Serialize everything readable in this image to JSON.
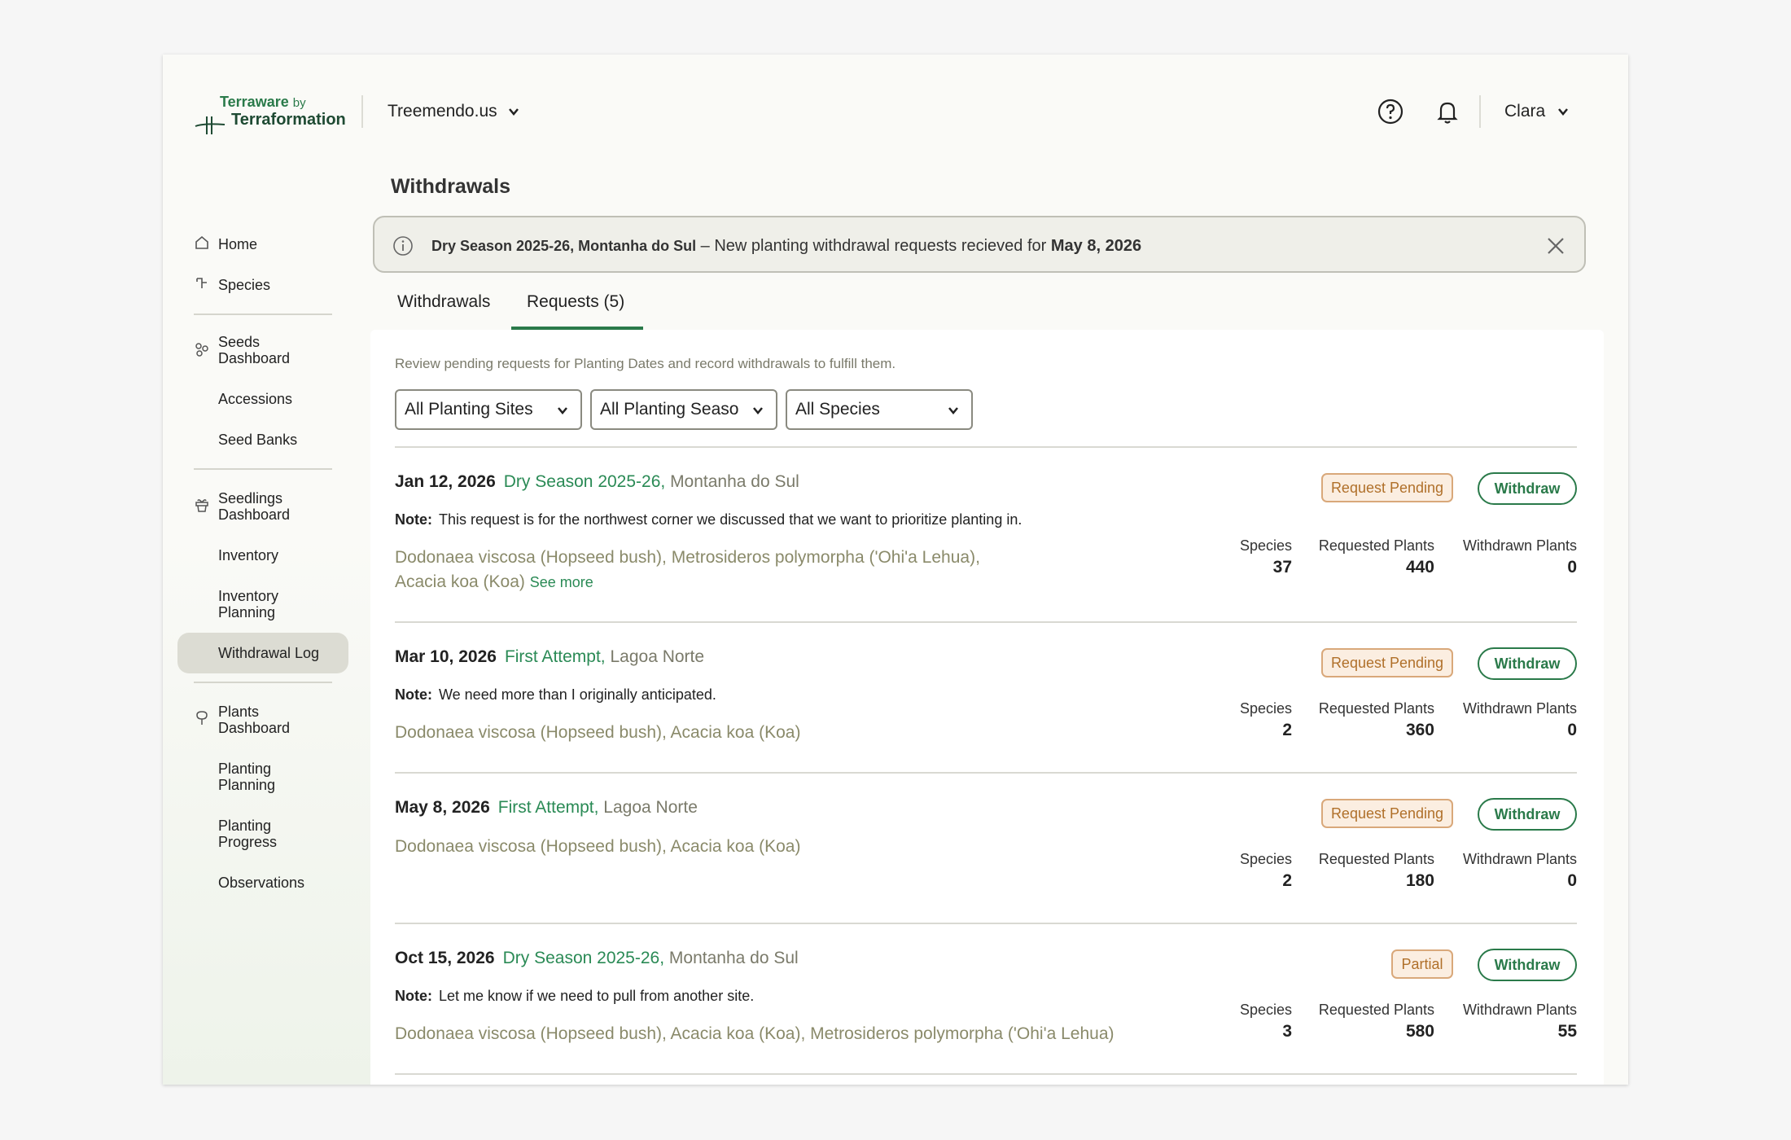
{
  "header": {
    "brand_top": "Terraware",
    "brand_by": "by",
    "brand_bottom": "Terraformation",
    "org_name": "Treemendo.us",
    "user_name": "Clara"
  },
  "sidebar": {
    "home": "Home",
    "species": "Species",
    "seeds_dashboard": [
      "Seeds",
      "Dashboard"
    ],
    "accessions": "Accessions",
    "seed_banks": "Seed Banks",
    "seedlings_dashboard": [
      "Seedlings",
      "Dashboard"
    ],
    "inventory": "Inventory",
    "inventory_planning": [
      "Inventory",
      "Planning"
    ],
    "withdrawal_log": "Withdrawal Log",
    "plants_dashboard": [
      "Plants",
      "Dashboard"
    ],
    "planting_planning": [
      "Planting",
      "Planning"
    ],
    "planting_progress": [
      "Planting",
      "Progress"
    ],
    "observations": "Observations"
  },
  "page": {
    "title": "Withdrawals"
  },
  "banner": {
    "bold_prefix": "Dry Season 2025-26, Montanha do Sul",
    "message": " – New planting withdrawal requests recieved for ",
    "date": "May 8, 2026"
  },
  "tabs": {
    "withdrawals": "Withdrawals",
    "requests": "Requests (5)"
  },
  "panel": {
    "description": "Review pending requests for Planting Dates and record withdrawals to fulfill them.",
    "filters": {
      "sites": "All Planting Sites",
      "seasons": "All Planting Seaso",
      "species": "All Species"
    }
  },
  "labels": {
    "note": "Note:",
    "species": "Species",
    "requested": "Requested Plants",
    "withdrawn": "Withdrawn Plants",
    "withdraw": "Withdraw",
    "see_more": "See more"
  },
  "requests": [
    {
      "date": "Jan 12, 2026",
      "season": "Dry Season 2025-26,",
      "site": " Montanha do Sul",
      "note": "This request is for the northwest corner we discussed that we want to prioritize planting in.",
      "species_line1": "Dodonaea viscosa (Hopseed bush), Metrosideros polymorpha ('Ohi'a Lehua),",
      "species_line2": "Acacia koa (Koa)",
      "status": "Request Pending",
      "species_count": "37",
      "requested": "440",
      "withdrawn": "0"
    },
    {
      "date": "Mar 10, 2026",
      "season": "First Attempt,",
      "site": " Lagoa Norte",
      "note": "We need more than I originally anticipated.",
      "species_line1": "Dodonaea viscosa (Hopseed bush), Acacia koa (Koa)",
      "status": "Request Pending",
      "species_count": "2",
      "requested": "360",
      "withdrawn": "0"
    },
    {
      "date": "May 8, 2026",
      "season": "First Attempt,",
      "site": " Lagoa Norte",
      "species_line1": "Dodonaea viscosa (Hopseed bush), Acacia koa (Koa)",
      "status": "Request Pending",
      "species_count": "2",
      "requested": "180",
      "withdrawn": "0"
    },
    {
      "date": "Oct 15, 2026",
      "season": "Dry Season 2025-26,",
      "site": " Montanha do Sul",
      "note": "Let me know if we need to pull from another site.",
      "species_line1": "Dodonaea viscosa (Hopseed bush), Acacia koa (Koa), Metrosideros polymorpha ('Ohi'a Lehua)",
      "status": "Partial",
      "species_count": "3",
      "requested": "580",
      "withdrawn": "55"
    }
  ],
  "colors": {
    "accent": "#2a7a4a",
    "pending_border": "#d9a87a",
    "pending_text": "#b0702a"
  }
}
